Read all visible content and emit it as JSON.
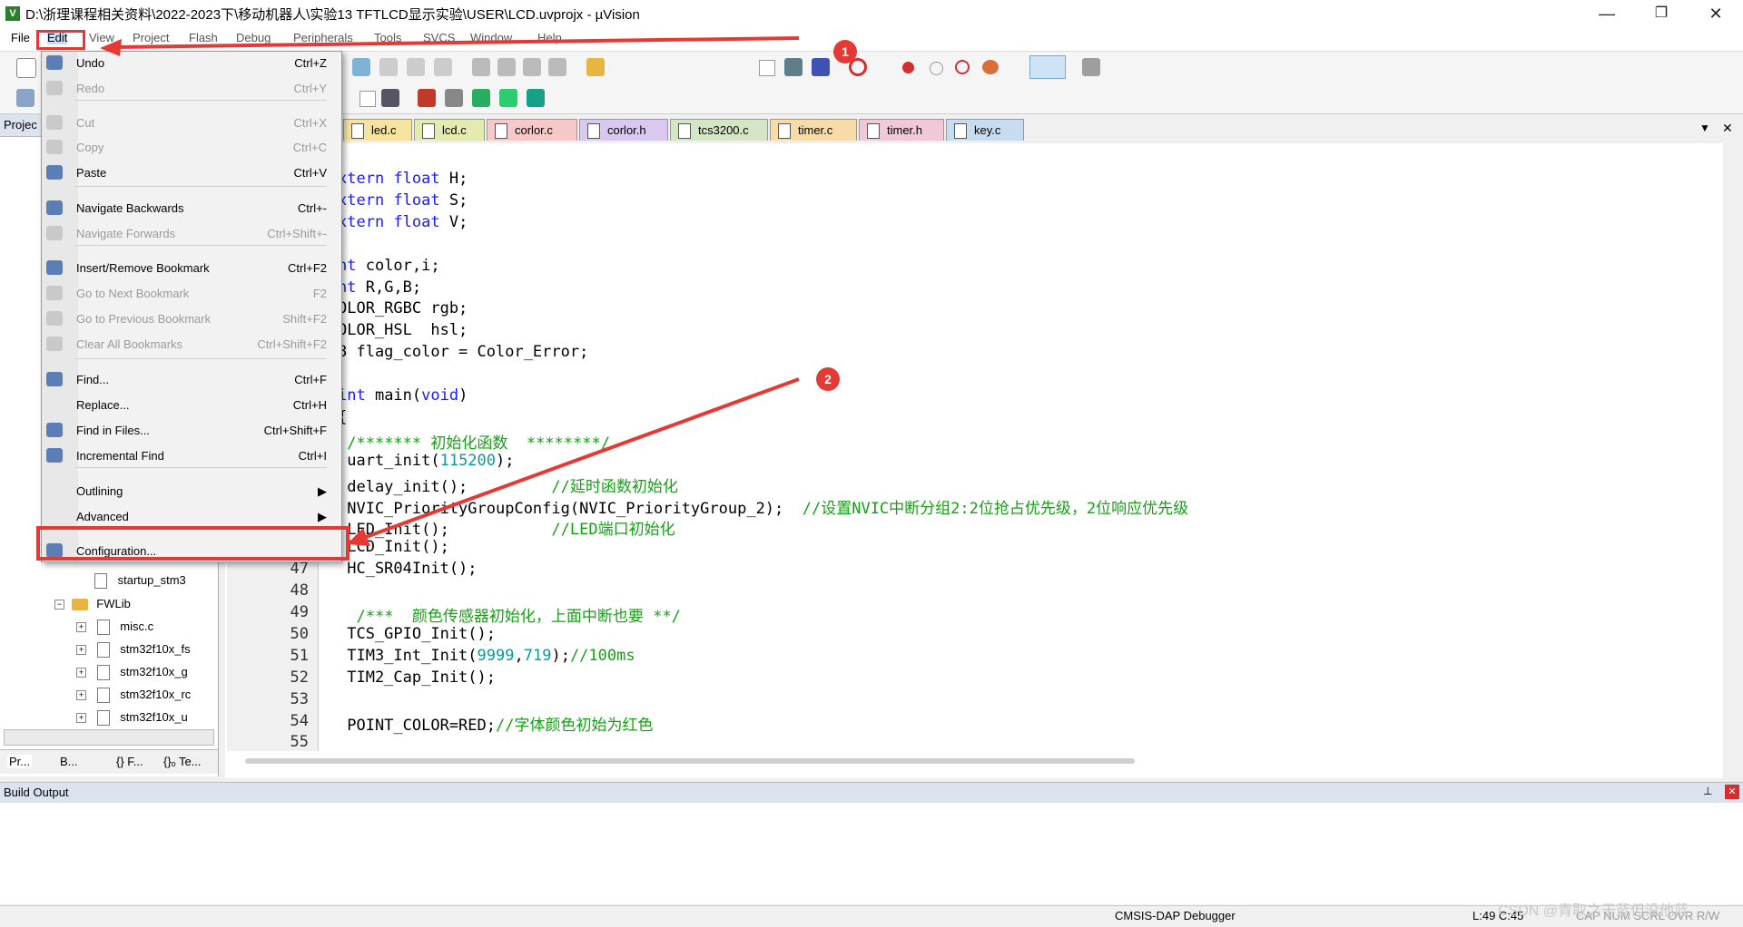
{
  "window": {
    "title": "D:\\浙理课程相关资料\\2022-2023下\\移动机器人\\实验13 TFTLCD显示实验\\USER\\LCD.uvprojx - µVision",
    "app_icon": "uvision-icon",
    "controls": {
      "minimize": "—",
      "restore": "❐",
      "close": "✕"
    }
  },
  "menubar": {
    "items": [
      "File",
      "Edit",
      "View",
      "Project",
      "Flash",
      "Debug",
      "Peripherals",
      "Tools",
      "SVCS",
      "Window",
      "Help"
    ]
  },
  "edit_menu": {
    "items": [
      {
        "label": "Undo",
        "shortcut": "Ctrl+Z",
        "enabled": true,
        "icon": "undo-icon"
      },
      {
        "label": "Redo",
        "shortcut": "Ctrl+Y",
        "enabled": false,
        "icon": "redo-icon"
      },
      {
        "label": "Cut",
        "shortcut": "Ctrl+X",
        "enabled": false,
        "icon": "cut-icon"
      },
      {
        "label": "Copy",
        "shortcut": "Ctrl+C",
        "enabled": false,
        "icon": "copy-icon"
      },
      {
        "label": "Paste",
        "shortcut": "Ctrl+V",
        "enabled": true,
        "icon": "paste-icon"
      },
      {
        "label": "Navigate Backwards",
        "shortcut": "Ctrl+-",
        "enabled": true,
        "icon": "arrow-left-icon"
      },
      {
        "label": "Navigate Forwards",
        "shortcut": "Ctrl+Shift+-",
        "enabled": false,
        "icon": "arrow-right-icon"
      },
      {
        "label": "Insert/Remove Bookmark",
        "shortcut": "Ctrl+F2",
        "enabled": true,
        "icon": "bookmark-icon"
      },
      {
        "label": "Go to Next Bookmark",
        "shortcut": "F2",
        "enabled": false,
        "icon": "next-bookmark-icon"
      },
      {
        "label": "Go to Previous Bookmark",
        "shortcut": "Shift+F2",
        "enabled": false,
        "icon": "prev-bookmark-icon"
      },
      {
        "label": "Clear All Bookmarks",
        "shortcut": "Ctrl+Shift+F2",
        "enabled": false,
        "icon": "clear-bookmarks-icon"
      },
      {
        "label": "Find...",
        "shortcut": "Ctrl+F",
        "enabled": true,
        "icon": "find-icon"
      },
      {
        "label": "Replace...",
        "shortcut": "Ctrl+H",
        "enabled": true,
        "icon": ""
      },
      {
        "label": "Find in Files...",
        "shortcut": "Ctrl+Shift+F",
        "enabled": true,
        "icon": "find-in-files-icon"
      },
      {
        "label": "Incremental Find",
        "shortcut": "Ctrl+I",
        "enabled": true,
        "icon": "incremental-find-icon"
      },
      {
        "label": "Outlining",
        "shortcut": "▶",
        "enabled": true,
        "icon": ""
      },
      {
        "label": "Advanced",
        "shortcut": "▶",
        "enabled": true,
        "icon": ""
      },
      {
        "label": "Configuration...",
        "shortcut": "",
        "enabled": true,
        "icon": "wrench-icon"
      }
    ]
  },
  "tabs": [
    "led.c",
    "lcd.c",
    "corlor.c",
    "corlor.h",
    "tcs3200.c",
    "timer.c",
    "timer.h",
    "key.c"
  ],
  "tab_colors": [
    "#f6e3a0",
    "#e4eab0",
    "#f7c8c8",
    "#d9c8ef",
    "#d4e6c6",
    "#f7dcaa",
    "#f0c8d8",
    "#c8dcef"
  ],
  "project_panel": {
    "header": "Projec",
    "tree": [
      {
        "label": "startup_stm3",
        "type": "file"
      },
      {
        "label": "FWLib",
        "type": "folder"
      },
      {
        "label": "misc.c",
        "type": "file"
      },
      {
        "label": "stm32f10x_fs",
        "type": "file"
      },
      {
        "label": "stm32f10x_g",
        "type": "file"
      },
      {
        "label": "stm32f10x_rc",
        "type": "file"
      },
      {
        "label": "stm32f10x_u",
        "type": "file"
      }
    ],
    "bottom_tabs": [
      "Pr...",
      "B...",
      "{} F...",
      "{}ₒ Te..."
    ]
  },
  "editor": {
    "lines": [
      {
        "n": "",
        "code": "xtern float H;"
      },
      {
        "n": "",
        "code": "xtern float S;"
      },
      {
        "n": "",
        "code": "xtern float V;"
      },
      {
        "n": "",
        "code": ""
      },
      {
        "n": "",
        "code": "nt color,i;"
      },
      {
        "n": "",
        "code": "nt R,G,B;"
      },
      {
        "n": "",
        "code": "OLOR_RGBC rgb;"
      },
      {
        "n": "",
        "code": "OLOR_HSL  hsl;"
      },
      {
        "n": "",
        "code": "8 flag_color = Color_Error;"
      },
      {
        "n": "",
        "code": ""
      },
      {
        "n": "",
        "code": "int main(void)"
      },
      {
        "n": "",
        "code": "{"
      },
      {
        "n": "",
        "code": " /******* 初始化函数  ********/"
      },
      {
        "n": "",
        "code": " uart_init(115200);"
      },
      {
        "n": "",
        "code": " delay_init();         //延时函数初始化"
      },
      {
        "n": "",
        "code": " NVIC_PriorityGroupConfig(NVIC_PriorityGroup_2);  //设置NVIC中断分组2:2位抢占优先级，2位响应优先级"
      },
      {
        "n": "",
        "code": " LED_Init();           //LED端口初始化"
      },
      {
        "n": "",
        "code": " LCD_Init();"
      },
      {
        "n": "47",
        "code": " HC_SR04Init();"
      },
      {
        "n": "48",
        "code": ""
      },
      {
        "n": "49",
        "code": "  /***  颜色传感器初始化，上面中断也要 **/"
      },
      {
        "n": "50",
        "code": " TCS_GPIO_Init();"
      },
      {
        "n": "51",
        "code": " TIM3_Int_Init(9999,719);//100ms"
      },
      {
        "n": "52",
        "code": " TIM2_Cap_Init();"
      },
      {
        "n": "53",
        "code": ""
      },
      {
        "n": "54",
        "code": " POINT_COLOR=RED;//字体颜色初始为红色"
      },
      {
        "n": "55",
        "code": ""
      }
    ]
  },
  "annotations": {
    "badge1": "1",
    "badge2": "2",
    "accent": "#e53935"
  },
  "build_output": {
    "title": "Build Output"
  },
  "statusbar": {
    "debugger": "CMSIS-DAP Debugger",
    "position": "L:49 C:45",
    "flags": "CAP  NUM  SCRL  OVR  R/W",
    "watermark": "CSDN @青取之于蓝但没他蓝"
  }
}
